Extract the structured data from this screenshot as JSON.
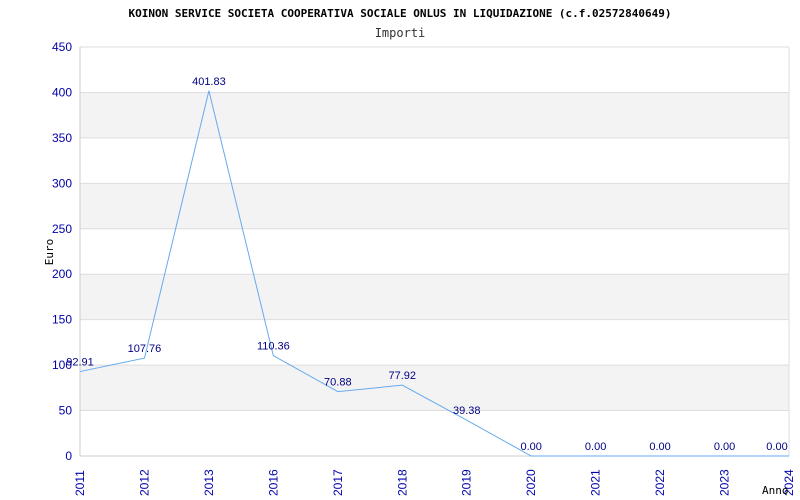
{
  "chart_data": {
    "type": "line",
    "title": "KOINON SERVICE SOCIETA COOPERATIVA SOCIALE ONLUS IN LIQUIDAZIONE (c.f.02572840649)",
    "subtitle": "Importi",
    "xlabel": "Anno",
    "ylabel": "Euro",
    "ylim": [
      0,
      450
    ],
    "yticks": [
      0,
      50,
      100,
      150,
      200,
      250,
      300,
      350,
      400,
      450
    ],
    "categories": [
      "2011",
      "2012",
      "2013",
      "2016",
      "2017",
      "2018",
      "2019",
      "2020",
      "2021",
      "2022",
      "2023",
      "2024"
    ],
    "values": [
      92.91,
      107.76,
      401.83,
      110.36,
      70.88,
      77.92,
      39.38,
      0.0,
      0.0,
      0.0,
      0.0,
      0.0
    ],
    "labels": [
      "92.91",
      "107.76",
      "401.83",
      "110.36",
      "70.88",
      "77.92",
      "39.38",
      "0.00",
      "0.00",
      "0.00",
      "0.00",
      "0.00"
    ],
    "grid": true,
    "colors": {
      "line": "#66aaee",
      "band": "#f3f3f3",
      "gridline": "#dddddd",
      "tick": "#0000aa",
      "label": "#000080"
    }
  }
}
